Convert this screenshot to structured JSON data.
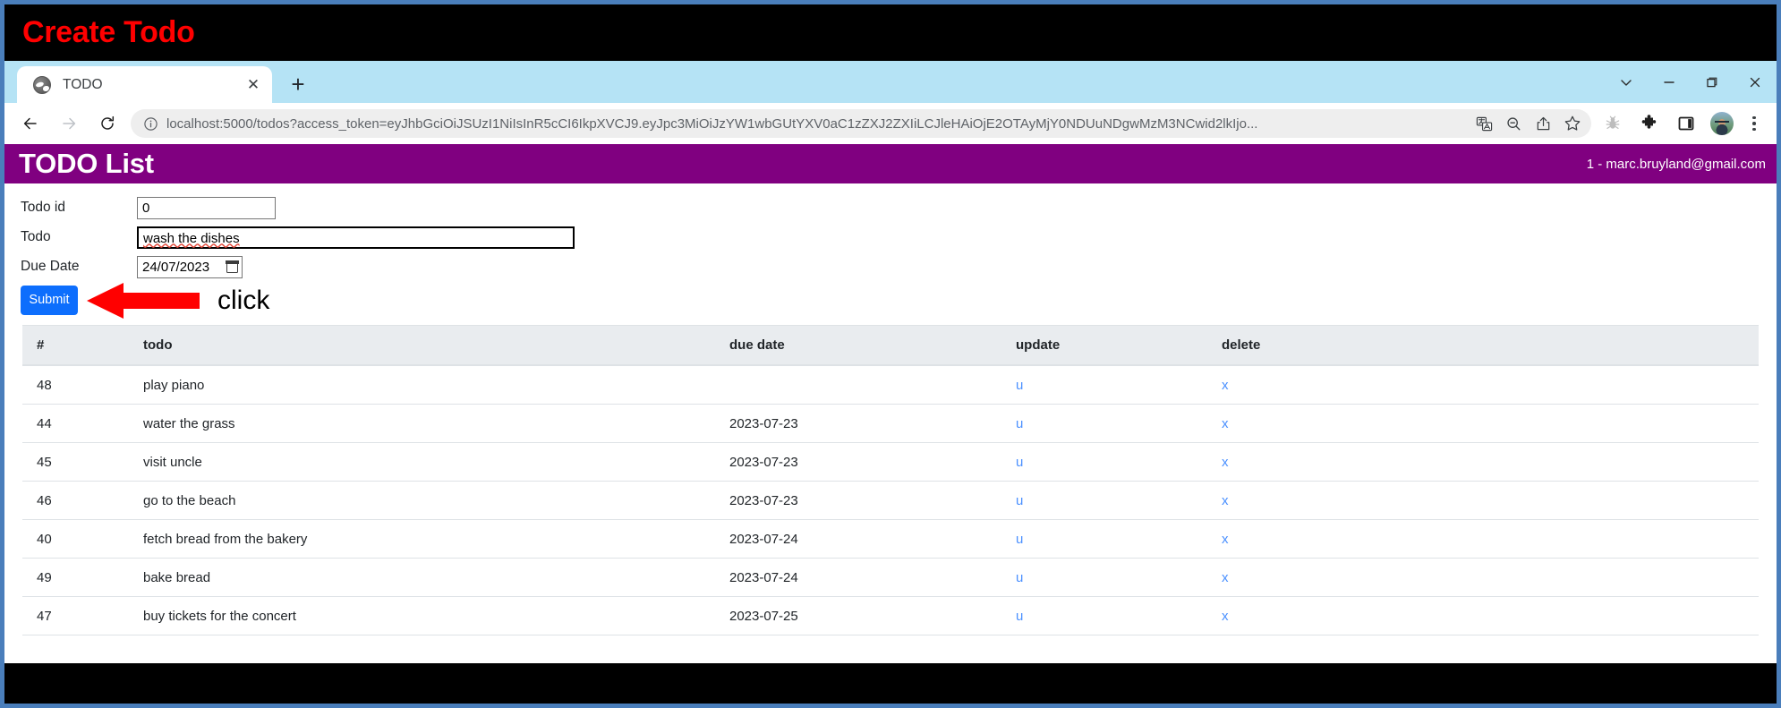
{
  "annotation": {
    "banner_title": "Create Todo",
    "banner_bg": "#000000",
    "banner_color": "#ff0000",
    "click_label": "click",
    "arrow_color": "#ff0000"
  },
  "browser": {
    "tab": {
      "title": "TODO",
      "favicon": "globe-icon",
      "close_label": "✕"
    },
    "new_tab_label": "+",
    "window_controls": {
      "tab_search": "chevron-down-icon",
      "minimize": "minimize-icon",
      "maximize": "maximize-icon",
      "close": "close-icon"
    },
    "nav": {
      "back": "back-arrow-icon",
      "forward": "forward-arrow-icon",
      "reload": "reload-icon"
    },
    "omnibox": {
      "site_info_icon": "info-circle-icon",
      "url": "localhost:5000/todos?access_token=eyJhbGciOiJSUzI1NiIsInR5cCI6IkpXVCJ9.eyJpc3MiOiJzYW1wbGUtYXV0aC1zZXJ2ZXIiLCJleHAiOjE2OTAyMjY0NDUuNDgwMzM3NCwid2lkIjo...",
      "actions": [
        "translate-icon",
        "zoom-out-icon",
        "share-icon",
        "bookmark-star-icon"
      ]
    },
    "extensions": [
      "bug-icon",
      "puzzle-piece-icon",
      "side-panel-icon"
    ],
    "profile": "avatar",
    "menu": "kebab-menu-icon",
    "tabstrip_bg": "#b5e3f5"
  },
  "app": {
    "header": {
      "title": "TODO List",
      "user": "1 - marc.bruyland@gmail.com",
      "bg": "#800080"
    },
    "form": {
      "fields": [
        {
          "label": "Todo id",
          "value": "0",
          "name": "todo-id"
        },
        {
          "label": "Todo",
          "value": "wash the dishes",
          "name": "todo-text"
        },
        {
          "label": "Due Date",
          "value": "24/07/2023",
          "name": "due-date"
        }
      ],
      "submit_label": "Submit",
      "submit_color": "#0d6efd"
    },
    "table": {
      "headers": [
        "#",
        "todo",
        "due date",
        "update",
        "delete"
      ],
      "update_link": "u",
      "delete_link": "x",
      "link_color": "#4a90ff",
      "rows": [
        {
          "id": "48",
          "todo": "play piano",
          "due": ""
        },
        {
          "id": "44",
          "todo": "water the grass",
          "due": "2023-07-23"
        },
        {
          "id": "45",
          "todo": "visit uncle",
          "due": "2023-07-23"
        },
        {
          "id": "46",
          "todo": "go to the beach",
          "due": "2023-07-23"
        },
        {
          "id": "40",
          "todo": "fetch bread from the bakery",
          "due": "2023-07-24"
        },
        {
          "id": "49",
          "todo": "bake bread",
          "due": "2023-07-24"
        },
        {
          "id": "47",
          "todo": "buy tickets for the concert",
          "due": "2023-07-25"
        }
      ]
    }
  }
}
